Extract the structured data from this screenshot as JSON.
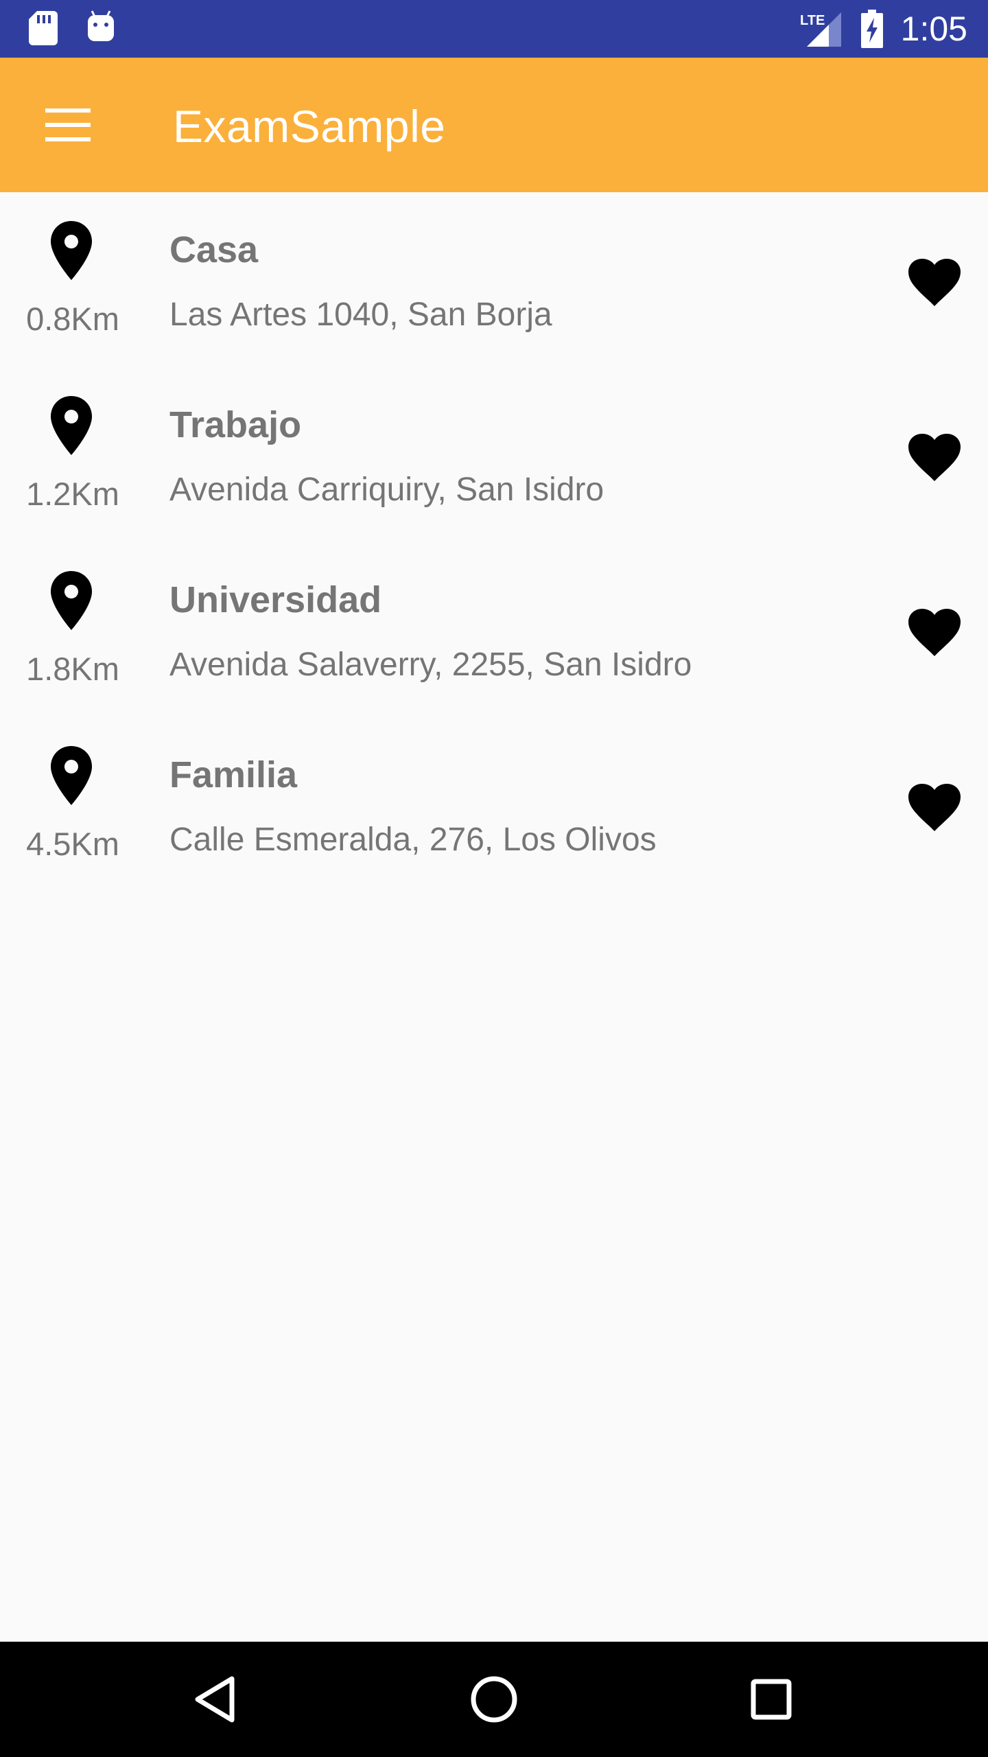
{
  "status_bar": {
    "time": "1:05",
    "network_label": "LTE",
    "icons": [
      "sd-card-icon",
      "android-icon",
      "lte-signal-icon",
      "battery-charging-icon"
    ]
  },
  "app_bar": {
    "title": "ExamSample",
    "menu_icon": "hamburger-menu-icon",
    "background_color": "#FBB03B"
  },
  "places": [
    {
      "name": "Casa",
      "address": "Las Artes 1040, San Borja",
      "distance": "0.8Km"
    },
    {
      "name": "Trabajo",
      "address": "Avenida Carriquiry, San Isidro",
      "distance": "1.2Km"
    },
    {
      "name": "Universidad",
      "address": "Avenida Salaverry, 2255, San Isidro",
      "distance": "1.8Km"
    },
    {
      "name": "Familia",
      "address": "Calle Esmeralda, 276, Los Olivos",
      "distance": "4.5Km"
    }
  ],
  "nav_bar": {
    "icons": [
      "back-icon",
      "home-icon",
      "recents-icon"
    ]
  },
  "colors": {
    "status_bar": "#303F9F",
    "app_bar": "#FBB03B",
    "text_secondary": "#757575",
    "background": "#FAFAFA"
  }
}
